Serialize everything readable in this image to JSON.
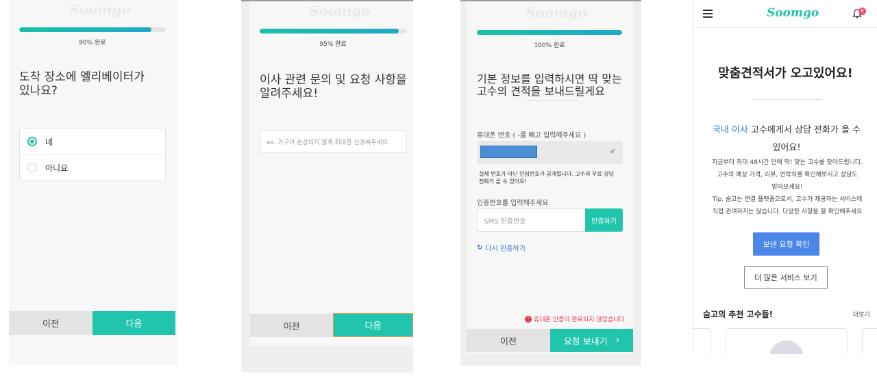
{
  "brand": "Soomgo",
  "screen1": {
    "progress_label": "90% 완료",
    "progress": 0.9,
    "question": "도착 장소에 엘리베이터가\n있나요?",
    "options": [
      {
        "label": "네",
        "selected": true
      },
      {
        "label": "아니요",
        "selected": false
      }
    ],
    "prev_label": "이전",
    "next_label": "다음"
  },
  "screen2": {
    "progress_label": "95% 완료",
    "progress": 0.95,
    "question": "이사 관련 문의 및 요청 사항을\n알려주세요!",
    "placeholder": "ex. 가구가 손상되지 않게 최대한 신경써주세요.",
    "prev_label": "이전",
    "next_label": "다음"
  },
  "screen3": {
    "progress_label": "100% 완료",
    "progress": 1.0,
    "question": "기본 정보를 입력하시면 딱 맞는\n고수의 견적을 보내드릴게요",
    "phone_label": "휴대폰 번호 ( -를 빼고 입력해주세요 )",
    "phone_notice": "실제 번호가 아닌 안심번호가 공개됩니다. 고수의 무료 상담\n전화가 올 수 있어요!",
    "code_label": "인증번호를 입력해주세요",
    "code_placeholder": "SMS 인증번호",
    "verify_button": "인증하기",
    "resend_label": "다시 인증하기",
    "error_text": "휴대폰 인증이 완료되지 않았습니다",
    "prev_label": "이전",
    "submit_label": "요청 보내기"
  },
  "screen4": {
    "logo": "Soomgo",
    "badge_count": "8",
    "headline": "맞춤견적서가 오고있어요!",
    "service_highlight": "국내 이사",
    "service_rest": " 고수에게서 상담 전화가 올 수",
    "service_line2": "있어요!",
    "desc": "지금부터 최대 48시간 안에 딱! 맞는 고수를 찾아드립니다.\n고수의 예상 가격, 리뷰, 연락처를 확인해보시고 상담도\n받아보세요!\nTip. 숨고는 연결 플랫폼으로서, 고수가 제공하는 서비스에\n직접 관여하지는 않습니다. 다양한 사항을 잘 확인해주세요",
    "primary_button": "보낸 요청 확인",
    "secondary_button": "더 많은 서비스 보기",
    "recommend_title": "숨고의 추천 고수들!",
    "more_link": "더보기"
  },
  "colors": {
    "teal": "#21c4ac",
    "blue_button": "#4a86e8",
    "error_red": "#e8344e",
    "link_blue": "#2a7ad4"
  }
}
